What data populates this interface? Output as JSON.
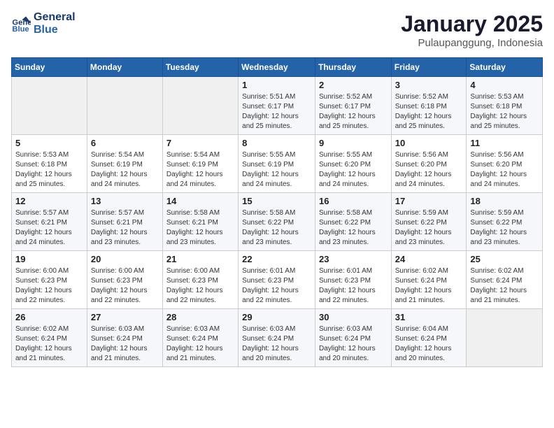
{
  "header": {
    "logo_line1": "General",
    "logo_line2": "Blue",
    "title": "January 2025",
    "subtitle": "Pulaupanggung, Indonesia"
  },
  "weekdays": [
    "Sunday",
    "Monday",
    "Tuesday",
    "Wednesday",
    "Thursday",
    "Friday",
    "Saturday"
  ],
  "weeks": [
    [
      {
        "day": "",
        "info": ""
      },
      {
        "day": "",
        "info": ""
      },
      {
        "day": "",
        "info": ""
      },
      {
        "day": "1",
        "info": "Sunrise: 5:51 AM\nSunset: 6:17 PM\nDaylight: 12 hours\nand 25 minutes."
      },
      {
        "day": "2",
        "info": "Sunrise: 5:52 AM\nSunset: 6:17 PM\nDaylight: 12 hours\nand 25 minutes."
      },
      {
        "day": "3",
        "info": "Sunrise: 5:52 AM\nSunset: 6:18 PM\nDaylight: 12 hours\nand 25 minutes."
      },
      {
        "day": "4",
        "info": "Sunrise: 5:53 AM\nSunset: 6:18 PM\nDaylight: 12 hours\nand 25 minutes."
      }
    ],
    [
      {
        "day": "5",
        "info": "Sunrise: 5:53 AM\nSunset: 6:18 PM\nDaylight: 12 hours\nand 25 minutes."
      },
      {
        "day": "6",
        "info": "Sunrise: 5:54 AM\nSunset: 6:19 PM\nDaylight: 12 hours\nand 24 minutes."
      },
      {
        "day": "7",
        "info": "Sunrise: 5:54 AM\nSunset: 6:19 PM\nDaylight: 12 hours\nand 24 minutes."
      },
      {
        "day": "8",
        "info": "Sunrise: 5:55 AM\nSunset: 6:19 PM\nDaylight: 12 hours\nand 24 minutes."
      },
      {
        "day": "9",
        "info": "Sunrise: 5:55 AM\nSunset: 6:20 PM\nDaylight: 12 hours\nand 24 minutes."
      },
      {
        "day": "10",
        "info": "Sunrise: 5:56 AM\nSunset: 6:20 PM\nDaylight: 12 hours\nand 24 minutes."
      },
      {
        "day": "11",
        "info": "Sunrise: 5:56 AM\nSunset: 6:20 PM\nDaylight: 12 hours\nand 24 minutes."
      }
    ],
    [
      {
        "day": "12",
        "info": "Sunrise: 5:57 AM\nSunset: 6:21 PM\nDaylight: 12 hours\nand 24 minutes."
      },
      {
        "day": "13",
        "info": "Sunrise: 5:57 AM\nSunset: 6:21 PM\nDaylight: 12 hours\nand 23 minutes."
      },
      {
        "day": "14",
        "info": "Sunrise: 5:58 AM\nSunset: 6:21 PM\nDaylight: 12 hours\nand 23 minutes."
      },
      {
        "day": "15",
        "info": "Sunrise: 5:58 AM\nSunset: 6:22 PM\nDaylight: 12 hours\nand 23 minutes."
      },
      {
        "day": "16",
        "info": "Sunrise: 5:58 AM\nSunset: 6:22 PM\nDaylight: 12 hours\nand 23 minutes."
      },
      {
        "day": "17",
        "info": "Sunrise: 5:59 AM\nSunset: 6:22 PM\nDaylight: 12 hours\nand 23 minutes."
      },
      {
        "day": "18",
        "info": "Sunrise: 5:59 AM\nSunset: 6:22 PM\nDaylight: 12 hours\nand 23 minutes."
      }
    ],
    [
      {
        "day": "19",
        "info": "Sunrise: 6:00 AM\nSunset: 6:23 PM\nDaylight: 12 hours\nand 22 minutes."
      },
      {
        "day": "20",
        "info": "Sunrise: 6:00 AM\nSunset: 6:23 PM\nDaylight: 12 hours\nand 22 minutes."
      },
      {
        "day": "21",
        "info": "Sunrise: 6:00 AM\nSunset: 6:23 PM\nDaylight: 12 hours\nand 22 minutes."
      },
      {
        "day": "22",
        "info": "Sunrise: 6:01 AM\nSunset: 6:23 PM\nDaylight: 12 hours\nand 22 minutes."
      },
      {
        "day": "23",
        "info": "Sunrise: 6:01 AM\nSunset: 6:23 PM\nDaylight: 12 hours\nand 22 minutes."
      },
      {
        "day": "24",
        "info": "Sunrise: 6:02 AM\nSunset: 6:24 PM\nDaylight: 12 hours\nand 21 minutes."
      },
      {
        "day": "25",
        "info": "Sunrise: 6:02 AM\nSunset: 6:24 PM\nDaylight: 12 hours\nand 21 minutes."
      }
    ],
    [
      {
        "day": "26",
        "info": "Sunrise: 6:02 AM\nSunset: 6:24 PM\nDaylight: 12 hours\nand 21 minutes."
      },
      {
        "day": "27",
        "info": "Sunrise: 6:03 AM\nSunset: 6:24 PM\nDaylight: 12 hours\nand 21 minutes."
      },
      {
        "day": "28",
        "info": "Sunrise: 6:03 AM\nSunset: 6:24 PM\nDaylight: 12 hours\nand 21 minutes."
      },
      {
        "day": "29",
        "info": "Sunrise: 6:03 AM\nSunset: 6:24 PM\nDaylight: 12 hours\nand 20 minutes."
      },
      {
        "day": "30",
        "info": "Sunrise: 6:03 AM\nSunset: 6:24 PM\nDaylight: 12 hours\nand 20 minutes."
      },
      {
        "day": "31",
        "info": "Sunrise: 6:04 AM\nSunset: 6:24 PM\nDaylight: 12 hours\nand 20 minutes."
      },
      {
        "day": "",
        "info": ""
      }
    ]
  ]
}
